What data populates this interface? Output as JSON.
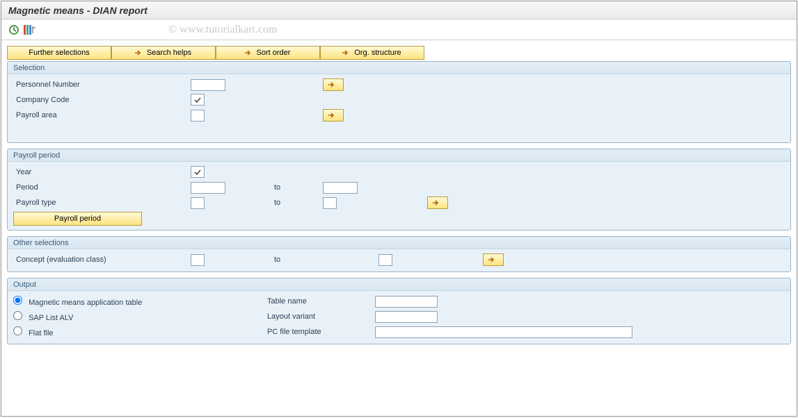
{
  "title": "Magnetic means - DIAN report",
  "watermark": "© www.tutorialkart.com",
  "toolbar": {
    "execute_icon": "execute-icon",
    "structure_icon": "structure-icon"
  },
  "buttons": {
    "further_selections": "Further selections",
    "search_helps": "Search helps",
    "sort_order": "Sort order",
    "org_structure": "Org. structure",
    "payroll_period": "Payroll period"
  },
  "labels": {
    "to": "to"
  },
  "groups": {
    "selection": {
      "title": "Selection",
      "personnel_number": "Personnel Number",
      "company_code": "Company Code",
      "payroll_area": "Payroll area"
    },
    "payroll_period": {
      "title": "Payroll period",
      "year": "Year",
      "period": "Period",
      "payroll_type": "Payroll type"
    },
    "other_selections": {
      "title": "Other selections",
      "concept": "Concept (evaluation class)"
    },
    "output": {
      "title": "Output",
      "magnetic_means": "Magnetic means application table",
      "sap_list_alv": "SAP List ALV",
      "flat_file": "Flat file",
      "table_name": "Table name",
      "layout_variant": "Layout variant",
      "pc_file_template": "PC file template"
    }
  },
  "values": {
    "personnel_number": "",
    "company_code": "",
    "payroll_area": "",
    "year": "",
    "period_from": "",
    "period_to": "",
    "payroll_type_from": "",
    "payroll_type_to": "",
    "concept_from": "",
    "concept_to": "",
    "table_name": "",
    "layout_variant": "",
    "pc_file_template": "",
    "output_selected": "magnetic_means"
  }
}
